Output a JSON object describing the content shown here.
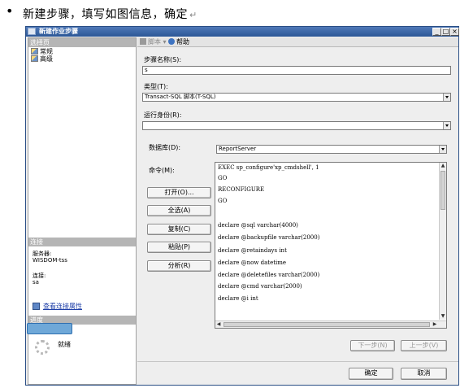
{
  "doc": {
    "bullet": "•",
    "instruction": "新建步骤，填写如图信息，确定",
    "para_mark": "↵"
  },
  "window": {
    "title": "新建作业步骤",
    "controls": {
      "minimize": "_",
      "maximize": "□",
      "close": "×"
    }
  },
  "left_panel": {
    "select_page_header": "选择页",
    "pages": [
      "常规",
      "高级"
    ],
    "connection_header": "连接",
    "server_label": "服务器:",
    "server_value": "WISDOM-tss",
    "connection_label": "连接:",
    "connection_value": "sa",
    "view_connection_link": "查看连接属性",
    "progress_header": "进度",
    "status": "就绪"
  },
  "toolbar": {
    "script": "脚本",
    "help": "帮助"
  },
  "form": {
    "step_name_label": "步骤名称(S):",
    "step_name_value": "s",
    "type_label": "类型(T):",
    "type_value": "Transact-SQL 脚本(T-SQL)",
    "run_as_label": "运行身份(R):",
    "run_as_value": "",
    "database_label": "数据库(D):",
    "database_value": "ReportServer",
    "command_label": "命令(M):",
    "command_lines": [
      "EXEC sp_configure'xp_cmdshell', 1",
      "GO",
      "RECONFIGURE",
      "GO",
      "",
      "declare @sql varchar(4000)",
      "declare @backupfile varchar(2000)",
      "declare @retaindays int",
      "declare @now datetime",
      "declare @deletefiles varchar(2000)",
      "declare @cmd varchar(2000)",
      "declare @i int"
    ]
  },
  "side_buttons": {
    "open": "打开(O)...",
    "select_all": "全选(A)",
    "copy": "复制(C)",
    "paste": "粘贴(P)",
    "parse": "分析(R)"
  },
  "nav_buttons": {
    "next": "下一步(N)",
    "prev": "上一步(V)"
  },
  "footer": {
    "ok": "确定",
    "cancel": "取消"
  }
}
